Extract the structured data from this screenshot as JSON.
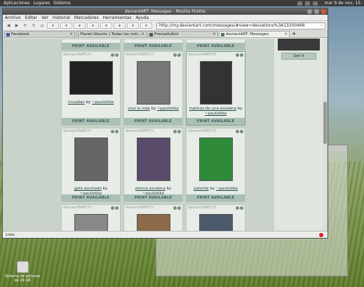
{
  "panel": {
    "menus": [
      "Aplicaciones",
      "Lugares",
      "Sistema"
    ],
    "clock": "mar 9 de nov, 15:"
  },
  "window": {
    "title": "deviantART: Messages - Mozilla Firefox",
    "menus": [
      "Archivo",
      "Editar",
      "Ver",
      "Historial",
      "Marcadores",
      "Herramientas",
      "Ayuda"
    ],
    "url": "http://my.deviantart.com/messages/#view=deviations%3A13200466",
    "tabs": [
      "Facebook",
      "Planet Ubuntu | Todas las noti...",
      "Prensafutbol",
      "deviantART: Messages"
    ],
    "status": "Listo"
  },
  "cards": [
    {
      "source": "deviantWATCH",
      "title": "Irrsublev",
      "author": "~paulistika",
      "print": "PRINT AVAILABLE"
    },
    {
      "source": "deviantWATCH",
      "title": "viva la vida",
      "author": "~paulistika",
      "print": "PRINT AVAILABLE"
    },
    {
      "source": "deviantWATCH",
      "title": "matices de una escalera",
      "author": "~paulistika",
      "print": "PRINT AVAILABLE"
    },
    {
      "source": "deviantWATCH",
      "title": "gato asustado",
      "author": "~paulistika",
      "print": "PRINT AVAILABLE"
    },
    {
      "source": "deviantWATCH",
      "title": "eterna escalera",
      "author": "~paulistika",
      "print": "PRINT AVAILABLE"
    },
    {
      "source": "deviantWATCH",
      "title": "patente",
      "author": "~paulistika",
      "print": "PRINT AVAILABLE"
    },
    {
      "source": "deviantWATCH",
      "title": "",
      "author": "",
      "print": ""
    },
    {
      "source": "deviantWATCH",
      "title": "",
      "author": "",
      "print": ""
    },
    {
      "source": "deviantWATCH",
      "title": "",
      "author": "",
      "print": ""
    }
  ],
  "sidebar": {
    "button": "Get It"
  },
  "desktop": {
    "icon_label_1": "Sistema de archivos",
    "icon_label_2": "de 29 GB"
  },
  "top_prints": [
    "PRINT AVAILABLE",
    "PRINT AVAILABLE",
    "PRINT AVAILABLE"
  ],
  "by_word": "by"
}
